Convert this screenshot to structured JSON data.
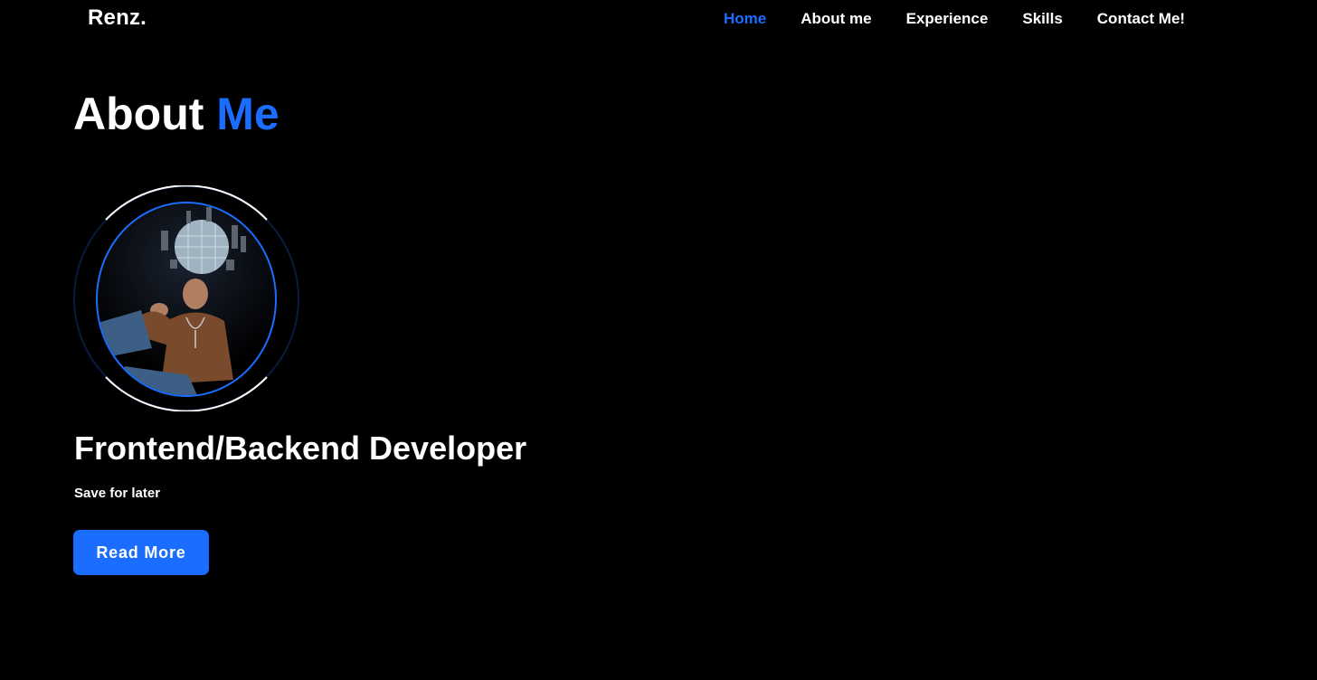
{
  "header": {
    "logo_text": "Renz",
    "logo_dot": ".",
    "nav": [
      {
        "label": "Home",
        "active": true
      },
      {
        "label": "About me",
        "active": false
      },
      {
        "label": "Experience",
        "active": false
      },
      {
        "label": "Skills",
        "active": false
      },
      {
        "label": "Contact Me!",
        "active": false
      }
    ]
  },
  "about": {
    "title_part1": "About ",
    "title_part2": "Me",
    "role": "Frontend/Backend Developer",
    "tagline": "Save for later",
    "button_label": "Read More"
  },
  "colors": {
    "accent": "#1a6dff",
    "background": "#000000",
    "text": "#ffffff"
  }
}
